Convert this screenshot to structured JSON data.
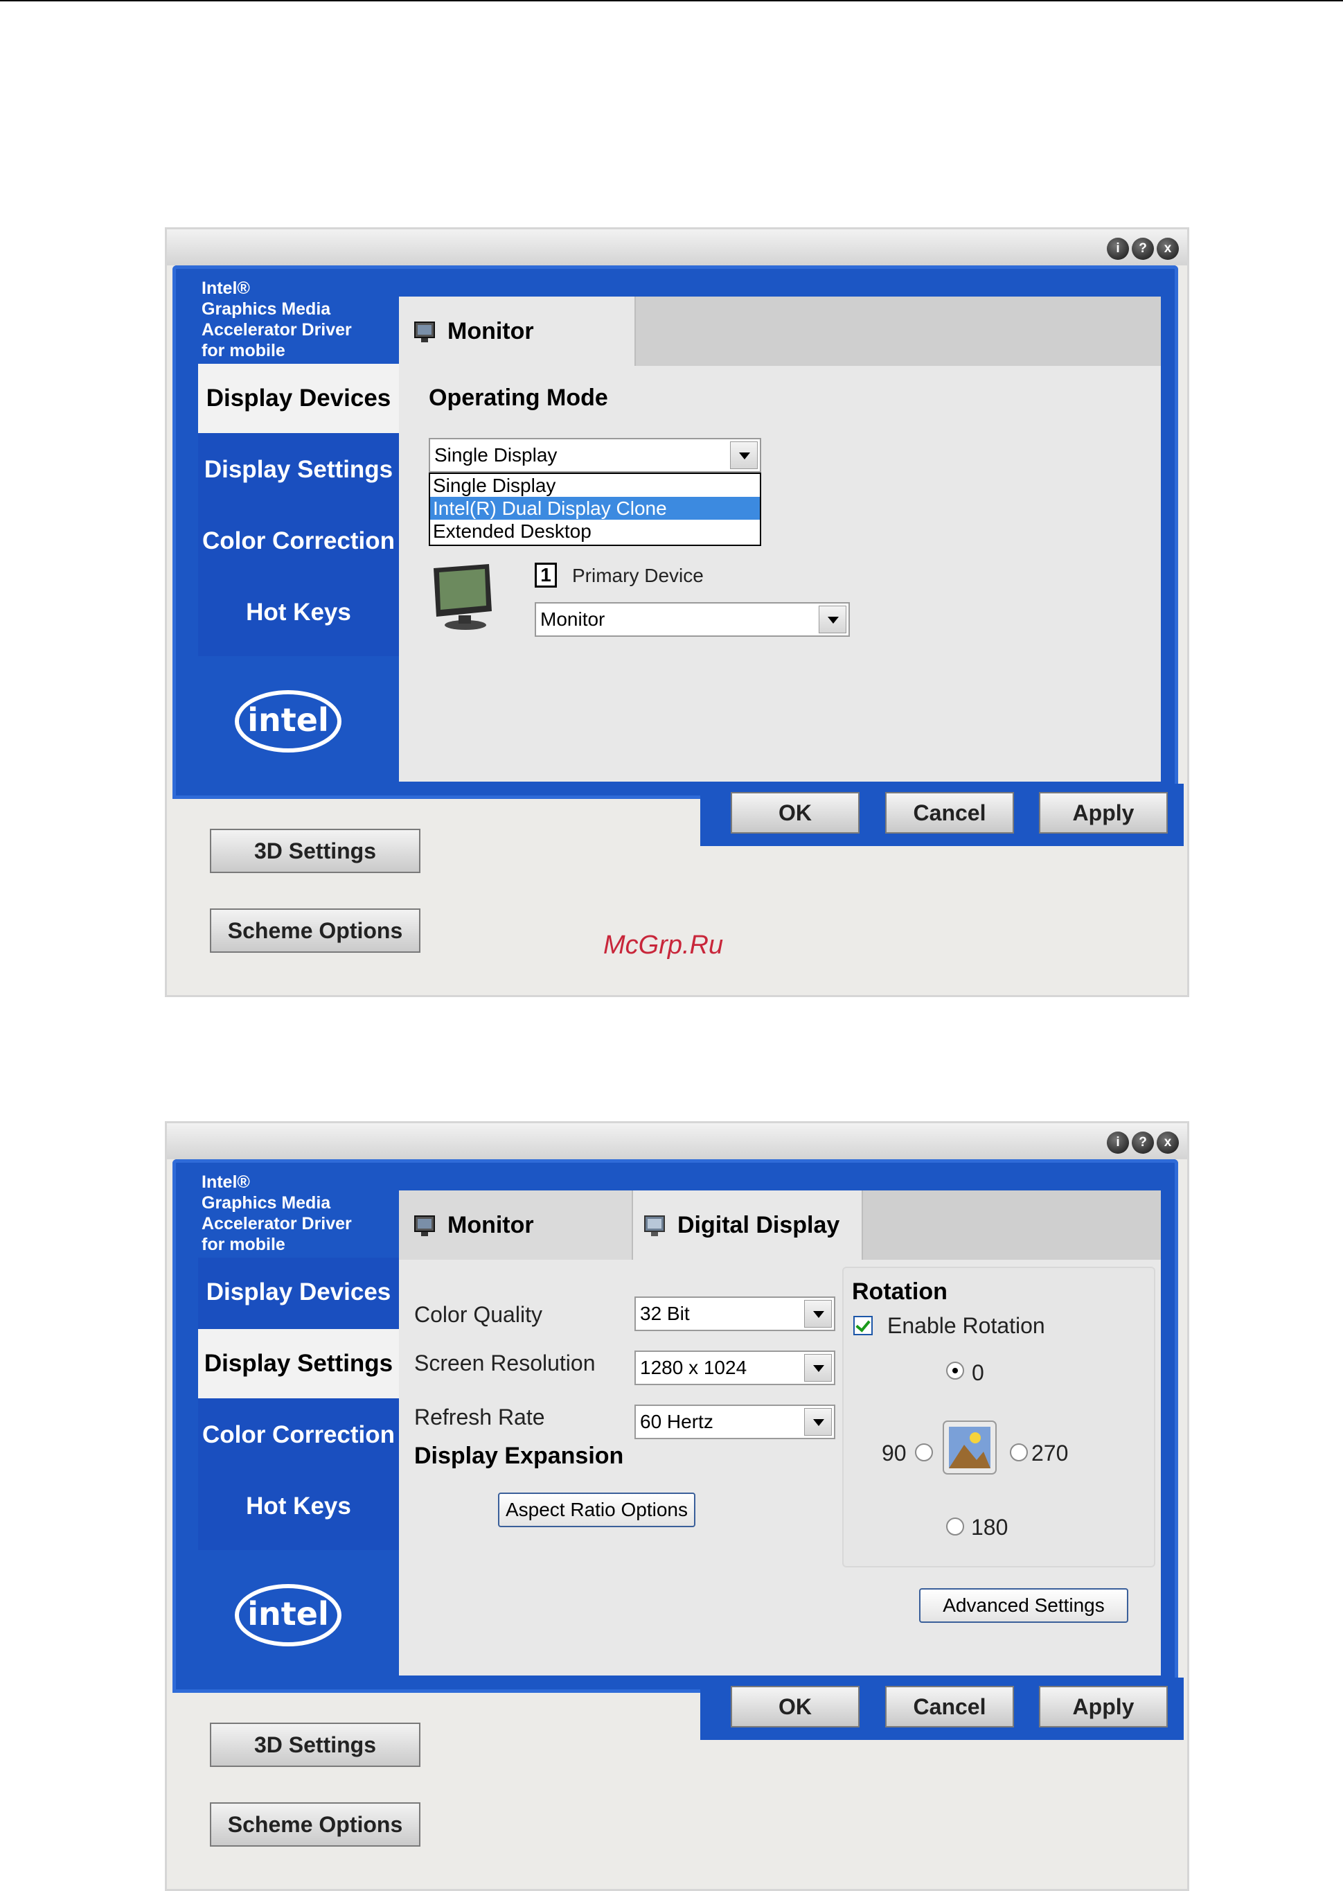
{
  "screens": [
    {
      "brand": [
        "Intel®",
        "Graphics Media",
        "Accelerator Driver",
        "for mobile"
      ],
      "nav": [
        "Display Devices",
        "Display Settings",
        "Color Correction",
        "Hot Keys"
      ],
      "tabs": [
        "Monitor"
      ],
      "operating_mode_title": "Operating Mode",
      "operating_mode_value": "Single Display",
      "operating_mode_options": [
        "Single Display",
        "Intel(R) Dual Display Clone",
        "Extended Desktop"
      ],
      "primary_number": "1",
      "primary_device_label": "Primary Device",
      "primary_device_value": "Monitor",
      "buttons": {
        "ok": "OK",
        "cancel": "Cancel",
        "apply": "Apply"
      },
      "side_buttons": {
        "settings_3d": "3D Settings",
        "scheme": "Scheme Options"
      },
      "watermark": "McGrp.Ru"
    },
    {
      "brand": [
        "Intel®",
        "Graphics Media",
        "Accelerator Driver",
        "for mobile"
      ],
      "nav": [
        "Display Devices",
        "Display Settings",
        "Color Correction",
        "Hot Keys"
      ],
      "tabs": [
        "Monitor",
        "Digital Display"
      ],
      "color_quality_label": "Color Quality",
      "color_quality_value": "32 Bit",
      "resolution_label": "Screen Resolution",
      "resolution_value": "1280 x 1024",
      "refresh_label": "Refresh Rate",
      "refresh_value": "60 Hertz",
      "expansion_title": "Display Expansion",
      "aspect_button": "Aspect Ratio Options",
      "rotation_title": "Rotation",
      "enable_rotation": "Enable Rotation",
      "rotation_options": [
        "0",
        "90",
        "270",
        "180"
      ],
      "advanced_button": "Advanced Settings",
      "buttons": {
        "ok": "OK",
        "cancel": "Cancel",
        "apply": "Apply"
      },
      "side_buttons": {
        "settings_3d": "3D Settings",
        "scheme": "Scheme Options"
      }
    }
  ],
  "icons": {
    "info": "i",
    "help": "?",
    "close": "x"
  }
}
